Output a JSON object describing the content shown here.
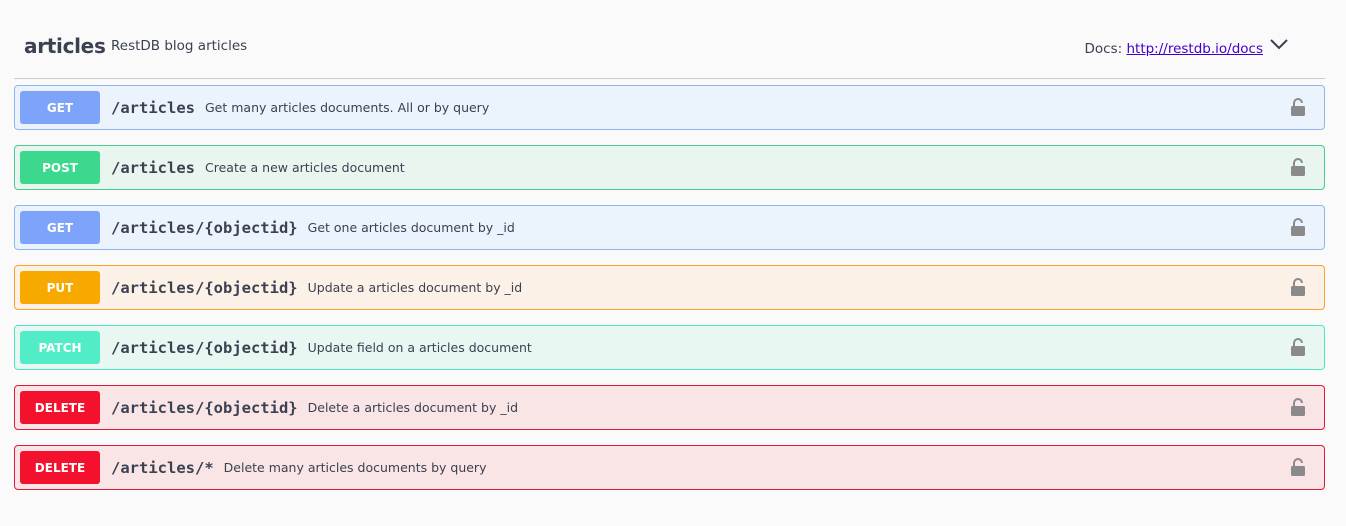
{
  "section": {
    "tag_name": "articles",
    "tag_description": "RestDB blog articles",
    "docs_label": "Docs:",
    "docs_link": "http://restdb.io/docs"
  },
  "operations": [
    {
      "method": "GET",
      "path": "/articles",
      "summary": "Get many articles documents. All or by query"
    },
    {
      "method": "POST",
      "path": "/articles",
      "summary": "Create a new articles document"
    },
    {
      "method": "GET",
      "path": "/articles/{objectid}",
      "summary": "Get one articles document by _id"
    },
    {
      "method": "PUT",
      "path": "/articles/{objectid}",
      "summary": "Update a articles document by _id"
    },
    {
      "method": "PATCH",
      "path": "/articles/{objectid}",
      "summary": "Update field on a articles document"
    },
    {
      "method": "DELETE",
      "path": "/articles/{objectid}",
      "summary": "Delete a articles document by _id"
    },
    {
      "method": "DELETE",
      "path": "/articles/*",
      "summary": "Delete many articles documents by query"
    }
  ],
  "colors": {
    "GET": "#7da3fb",
    "POST": "#3bd88d",
    "PUT": "#f8a900",
    "PATCH": "#52ecc7",
    "DELETE": "#f4112e"
  },
  "icons": {
    "lock": "lock-icon",
    "toggle": "chevron-down-icon"
  }
}
